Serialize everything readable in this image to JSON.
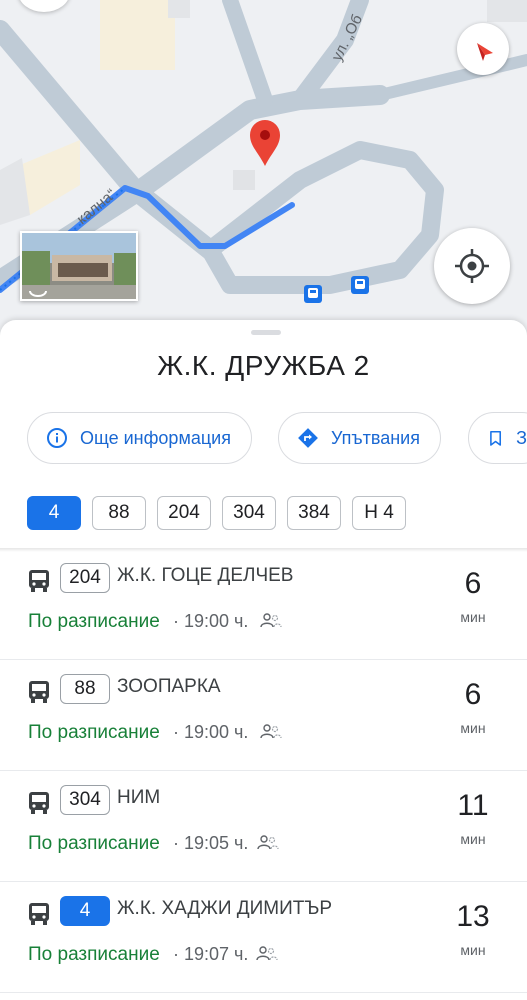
{
  "map": {
    "street_label_1": "ул. „Об",
    "street_label_2": "кална“",
    "accent_route_color": "#4285f4",
    "pin_color": "#ea4335"
  },
  "stop": {
    "title": "Ж.К. ДРУЖБА 2"
  },
  "actions": {
    "more_info": "Още информация",
    "directions": "Упътвания",
    "save": "З"
  },
  "route_filters": [
    {
      "label": "4",
      "selected": true
    },
    {
      "label": "88",
      "selected": false
    },
    {
      "label": "204",
      "selected": false
    },
    {
      "label": "304",
      "selected": false
    },
    {
      "label": "384",
      "selected": false
    },
    {
      "label": "Н 4",
      "selected": false
    }
  ],
  "departures": [
    {
      "route": "204",
      "destination": "Ж.К. ГОЦЕ ДЕЛЧЕВ",
      "status": "По разписание",
      "time": "· 19:00 ч.",
      "minutes": "6",
      "unit": "мин"
    },
    {
      "route": "88",
      "destination": "ЗООПАРКА",
      "status": "По разписание",
      "time": "· 19:00 ч.",
      "minutes": "6",
      "unit": "мин"
    },
    {
      "route": "304",
      "destination": "НИМ",
      "status": "По разписание",
      "time": "· 19:05 ч.",
      "minutes": "11",
      "unit": "мин"
    },
    {
      "route": "4",
      "destination": "Ж.К. ХАДЖИ ДИМИТЪР",
      "status": "По разписание",
      "time": "· 19:07 ч.",
      "minutes": "13",
      "unit": "мин"
    }
  ],
  "icons": {
    "compass": "compass-icon",
    "locate": "my-location-icon",
    "info": "info-icon",
    "directions": "directions-icon",
    "bookmark": "bookmark-icon",
    "bus": "bus-icon",
    "crowd": "crowd-icon",
    "pin": "map-pin-icon"
  }
}
